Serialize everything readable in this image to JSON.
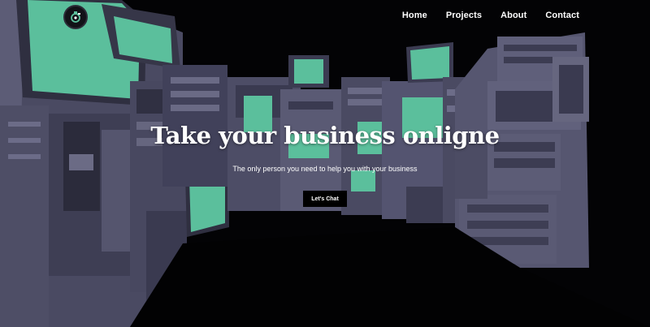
{
  "nav": {
    "items": [
      {
        "label": "Home"
      },
      {
        "label": "Projects"
      },
      {
        "label": "About"
      },
      {
        "label": "Contact"
      }
    ]
  },
  "logo": {
    "icon": "gear-bulb-icon"
  },
  "hero": {
    "title": "Take your business onligne",
    "subtitle": "The only person you need to help you with your business",
    "cta_label": "Let's Chat",
    "background": "monitors-tunnel-illustration"
  },
  "colors": {
    "screen": "#5bbf9c",
    "casing": "#5a5a72",
    "background": "#000000",
    "text": "#ffffff"
  }
}
